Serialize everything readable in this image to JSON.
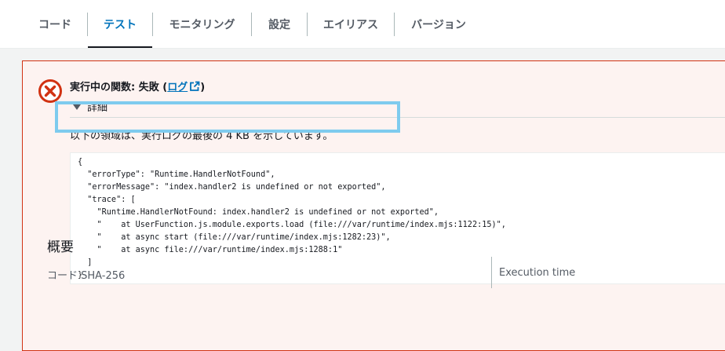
{
  "tabs": [
    {
      "label": "コード"
    },
    {
      "label": "テスト"
    },
    {
      "label": "モニタリング"
    },
    {
      "label": "設定"
    },
    {
      "label": "エイリアス"
    },
    {
      "label": "バージョン"
    }
  ],
  "active_tab": "テスト",
  "result": {
    "title_prefix": "実行中の関数: 失敗 (",
    "log_link": "ログ",
    "title_suffix": ")",
    "details_label": "詳細",
    "description": "以下の領域は、実行ログの最後の 4 KB を示しています。",
    "code_lines": [
      "{",
      "  \"errorType\": \"Runtime.HandlerNotFound\",",
      "  \"errorMessage\": \"index.handler2 is undefined or not exported\",",
      "  \"trace\": [",
      "    \"Runtime.HandlerNotFound: index.handler2 is undefined or not exported\",",
      "    \"    at UserFunction.js.module.exports.load (file:///var/runtime/index.mjs:1122:15)\",",
      "    \"    at async start (file:///var/runtime/index.mjs:1282:23)\",",
      "    \"    at async file:///var/runtime/index.mjs:1288:1\"",
      "  ]",
      "}"
    ]
  },
  "summary": {
    "heading": "概要",
    "code_sha_label": "コード SHA-256",
    "execution_time_label": "Execution time"
  },
  "colors": {
    "accent": "#0073bb",
    "error": "#d13212",
    "highlight": "#7ecbee"
  }
}
